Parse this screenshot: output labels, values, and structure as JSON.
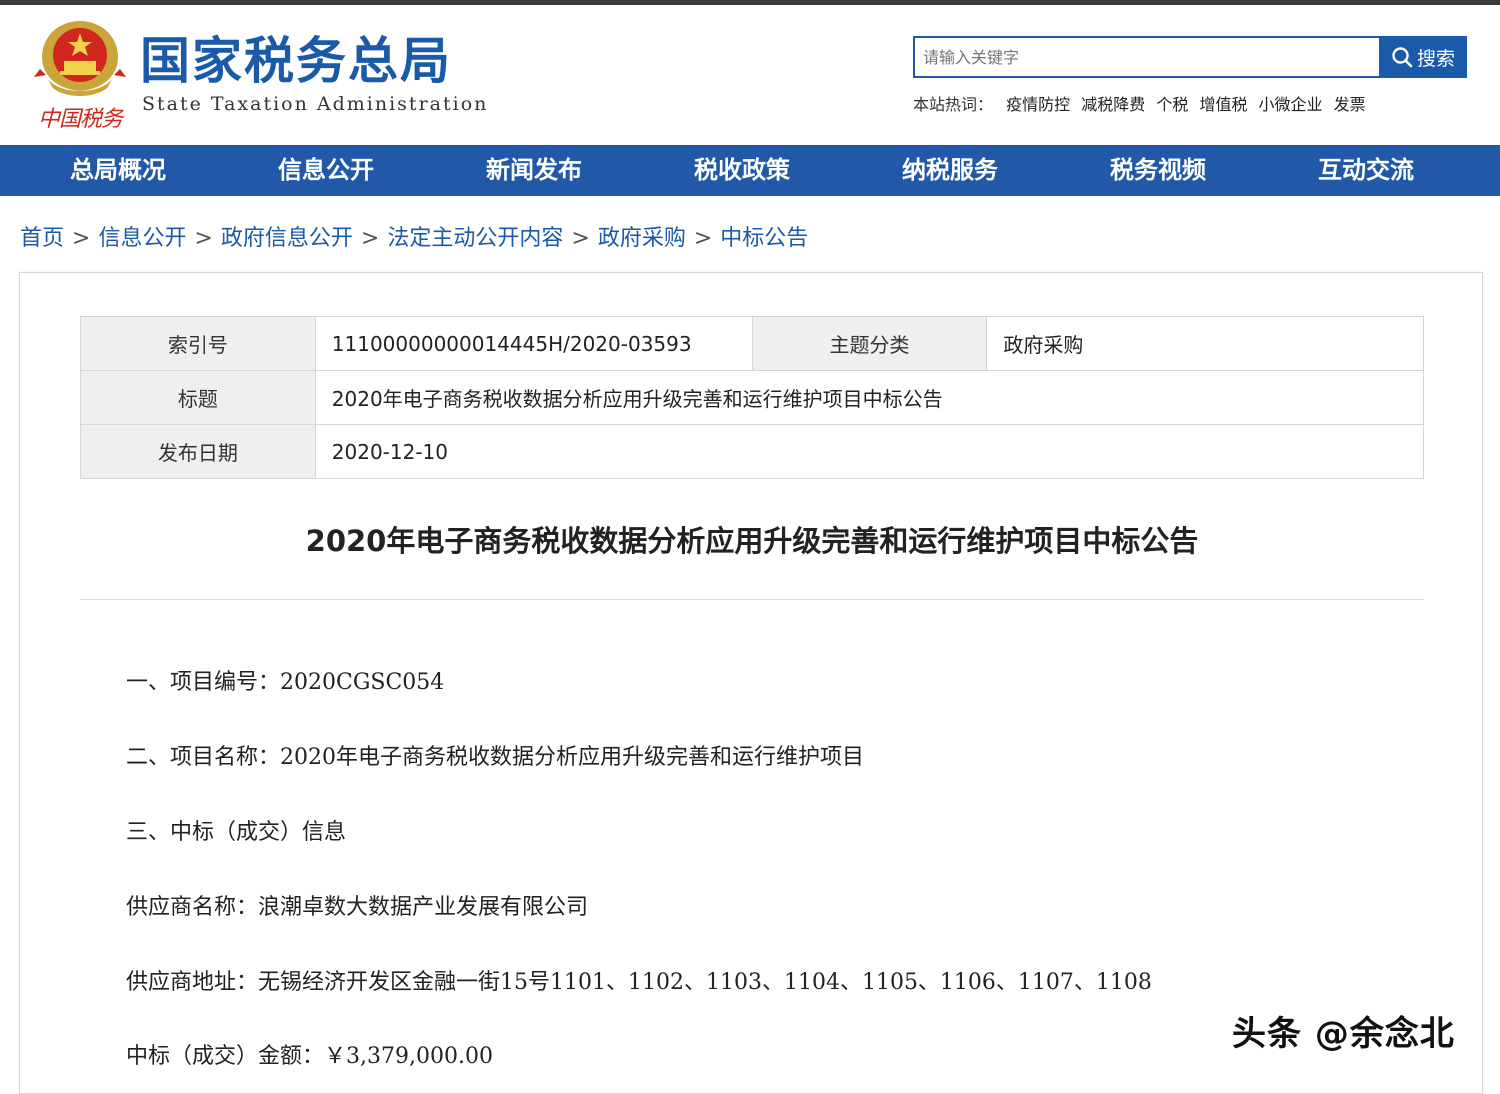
{
  "header": {
    "site_name_cn": "国家税务总局",
    "site_name_en": "State Taxation Administration",
    "seal_text": "中国税务"
  },
  "search": {
    "placeholder": "请输入关键字",
    "button_label": "搜索",
    "hot_label": "本站热词：",
    "hot_words": [
      "疫情防控",
      "减税降费",
      "个税",
      "增值税",
      "小微企业",
      "发票"
    ]
  },
  "nav": {
    "items": [
      "总局概况",
      "信息公开",
      "新闻发布",
      "税收政策",
      "纳税服务",
      "税务视频",
      "互动交流"
    ]
  },
  "breadcrumb": {
    "items": [
      "首页",
      "信息公开",
      "政府信息公开",
      "法定主动公开内容",
      "政府采购",
      "中标公告"
    ],
    "separator": ">"
  },
  "meta": {
    "index_label": "索引号",
    "index_value": "11100000000014445H/2020-03593",
    "category_label": "主题分类",
    "category_value": "政府采购",
    "title_label": "标题",
    "title_value": "2020年电子商务税收数据分析应用升级完善和运行维护项目中标公告",
    "date_label": "发布日期",
    "date_value": "2020-12-10"
  },
  "article": {
    "title": "2020年电子商务税收数据分析应用升级完善和运行维护项目中标公告",
    "paragraphs": [
      "一、项目编号：2020CGSC054",
      "二、项目名称：2020年电子商务税收数据分析应用升级完善和运行维护项目",
      "三、中标（成交）信息",
      "供应商名称：浪潮卓数大数据产业发展有限公司",
      "供应商地址：无锡经济开发区金融一街15号1101、1102、1103、1104、1105、1106、1107、1108",
      "中标（成交）金额：￥3,379,000.00"
    ]
  },
  "watermark": "头条 @余念北",
  "colors": {
    "brand_blue": "#1a5aa8",
    "nav_blue": "#2159a8",
    "seal_red": "#d0261d"
  }
}
